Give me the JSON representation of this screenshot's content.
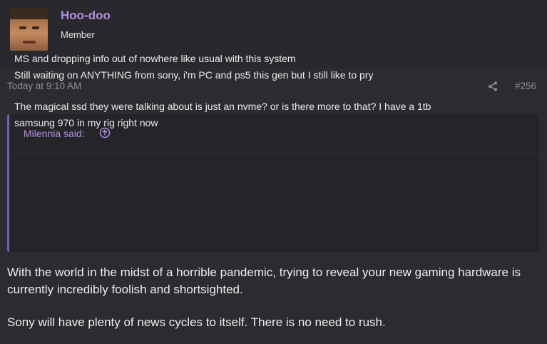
{
  "user": {
    "name": "Hoo-doo",
    "title": "Member",
    "avatar_icon": "user-avatar"
  },
  "post": {
    "timestamp": "Today at 9:10 AM",
    "number": "#256",
    "share_icon": "share-icon"
  },
  "quote": {
    "author": "Milennia said:",
    "arrow_icon": "arrow-up-circle-icon",
    "lines": [
      "MS and dropping info out of nowhere like usual with this system",
      "Still waiting on ANYTHING from sony, i'm PC and ps5 this gen but I still like to pry",
      "The magical ssd they were talking about is just an nvme? or is there more to that? I have a 1tb",
      "samsung 970 in my rig right now"
    ]
  },
  "message": {
    "paragraph1_line1": "With the world in the midst of a horrible pandemic, trying to reveal your new gaming hardware is",
    "paragraph1_line2": "currently incredibly foolish and shortsighted.",
    "paragraph2": "Sony will have plenty of news cycles to itself. There is no need to rush."
  },
  "colors": {
    "accent": "#b48ee0",
    "quote_border": "#7d5cb6",
    "background": "#2c2c30",
    "header_bg": "#29292d",
    "muted": "#8f8f95"
  }
}
